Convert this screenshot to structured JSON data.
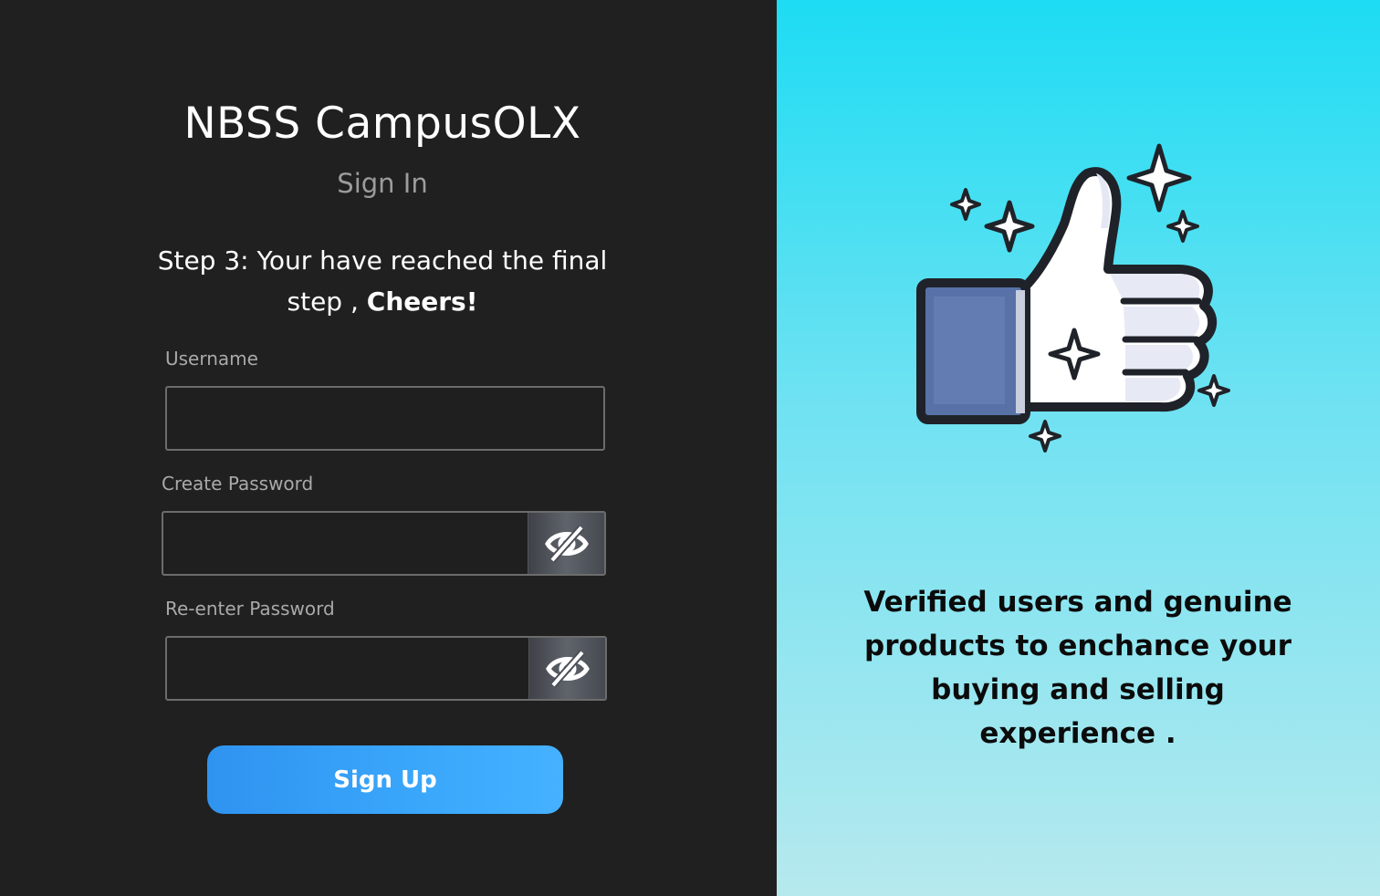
{
  "app": {
    "title": "NBSS CampusOLX",
    "subtitle": "Sign In"
  },
  "step": {
    "text": "Step 3: Your have reached the final step , ",
    "emphasis": "Cheers!"
  },
  "form": {
    "username": {
      "label": "Username",
      "value": "",
      "placeholder": ""
    },
    "create_password": {
      "label": "Create Password",
      "value": "",
      "placeholder": ""
    },
    "reenter_password": {
      "label": "Re-enter Password",
      "value": "",
      "placeholder": ""
    },
    "submit_label": "Sign Up"
  },
  "promo": {
    "illustration_icon": "thumbs-up-sparkles-icon",
    "tagline": "Verified users and genuine products to enchance your buying and selling experience ."
  },
  "colors": {
    "left_bg": "#202020",
    "right_gradient_top": "#1ddcf3",
    "right_gradient_bottom": "#b6e9ee",
    "button": "#3aa7fb",
    "thumb_cuff": "#5872a7"
  }
}
